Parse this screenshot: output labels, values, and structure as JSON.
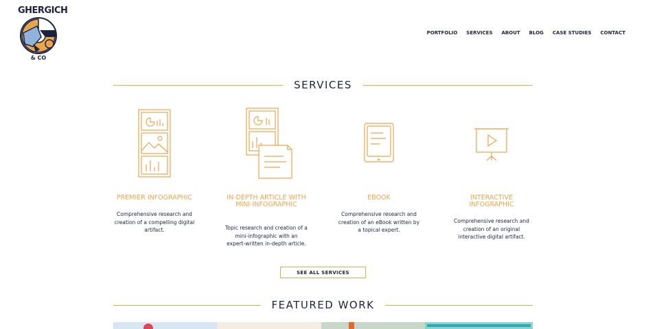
{
  "brand": {
    "wordmark": "GHERGICH",
    "co": "& CO"
  },
  "nav": {
    "items": [
      "PORTFOLIO",
      "SERVICES",
      "ABOUT",
      "BLOG",
      "CASE STUDIES",
      "CONTACT"
    ]
  },
  "services": {
    "heading": "SERVICES",
    "items": [
      {
        "title": "PREMIER INFOGRAPHIC",
        "description": "Comprehensive research and creation of a compelling digital artifact.",
        "icon": "infographic-poster-icon"
      },
      {
        "title": "IN-DEPTH ARTICLE WITH MINI-INFOGRAPHIC",
        "description": "Topic research and creation of a mini-infographic with an expert-written in-depth article.",
        "icon": "article-document-icon"
      },
      {
        "title": "EBOOK",
        "description": "Comprehensive research and creation of an eBook written by a topical expert.",
        "icon": "tablet-ebook-icon"
      },
      {
        "title": "INTERACTIVE INFOGRAPHIC",
        "description": "Comprehensive research and creation of an original interactive digital artifact.",
        "icon": "presentation-play-icon"
      }
    ],
    "see_all_label": "SEE ALL SERVICES"
  },
  "featured": {
    "heading": "FEATURED WORK"
  },
  "colors": {
    "accent": "#e9a54a",
    "navy": "#1c2340"
  }
}
